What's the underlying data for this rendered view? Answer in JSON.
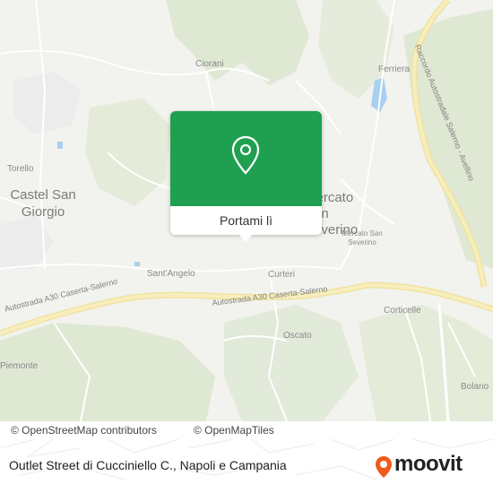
{
  "map": {
    "labels": {
      "castel_san_giorgio": "Castel San Giorgio",
      "mercato_san_severino": "Mercato San Severino",
      "mercato_san_severino_small": "Mercato San Severino",
      "torello": "Torello",
      "ciorani": "Ciorani",
      "ferriera": "Ferriera",
      "sant_angelo": "Sant'Angelo",
      "curteri": "Curteri",
      "corticelle": "Corticelle",
      "oscato": "Oscato",
      "piemonte": "Piemonte",
      "bolano": "Bolano",
      "autostrada_left": "Autostrada A30 Caserta-Salerno",
      "autostrada_mid": "Autostrada A30 Caserta-Salerno",
      "raccordo": "Raccordo Autostradale Salerno - Avellino"
    },
    "colors": {
      "land": "#f2f2ee",
      "green": "#dfe8d3",
      "water": "#a8d0f0",
      "highway": "#f4e8a8",
      "road": "#ffffff",
      "accent": "#1fa050"
    }
  },
  "popup": {
    "icon": "location-pin-icon",
    "button_label": "Portami lì"
  },
  "attribution": {
    "osm": "© OpenStreetMap contributors",
    "omt": "© OpenMapTiles"
  },
  "footer": {
    "title": "Outlet Street di Cucciniello C., Napoli e Campania",
    "logo_text": "moovit",
    "logo_icon": "moovit-logo-icon"
  }
}
